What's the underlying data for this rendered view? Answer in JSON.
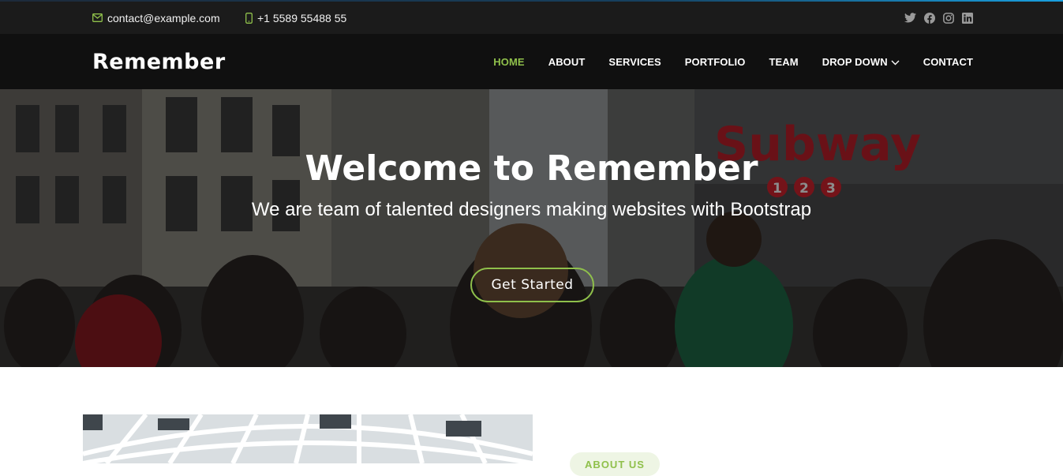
{
  "topbar": {
    "email": "contact@example.com",
    "phone": "+1 5589 55488 55",
    "socials": [
      "twitter-icon",
      "facebook-icon",
      "instagram-icon",
      "linkedin-icon"
    ]
  },
  "header": {
    "logo": "Remember",
    "nav": [
      {
        "label": "HOME",
        "active": true
      },
      {
        "label": "ABOUT",
        "active": false
      },
      {
        "label": "SERVICES",
        "active": false
      },
      {
        "label": "PORTFOLIO",
        "active": false
      },
      {
        "label": "TEAM",
        "active": false
      },
      {
        "label": "DROP DOWN",
        "active": false,
        "has_dropdown": true
      },
      {
        "label": "CONTACT",
        "active": false
      }
    ]
  },
  "hero": {
    "title": "Welcome to Remember",
    "subtitle": "We are team of talented designers making websites with Bootstrap",
    "cta_label": "Get Started",
    "sign_text": "Subway",
    "sign_numbers": [
      "1",
      "2",
      "3"
    ]
  },
  "about": {
    "badge": "ABOUT US"
  },
  "colors": {
    "accent": "#8fc04b",
    "topbar_bg": "#1b1b1b",
    "header_bg": "#101010"
  }
}
